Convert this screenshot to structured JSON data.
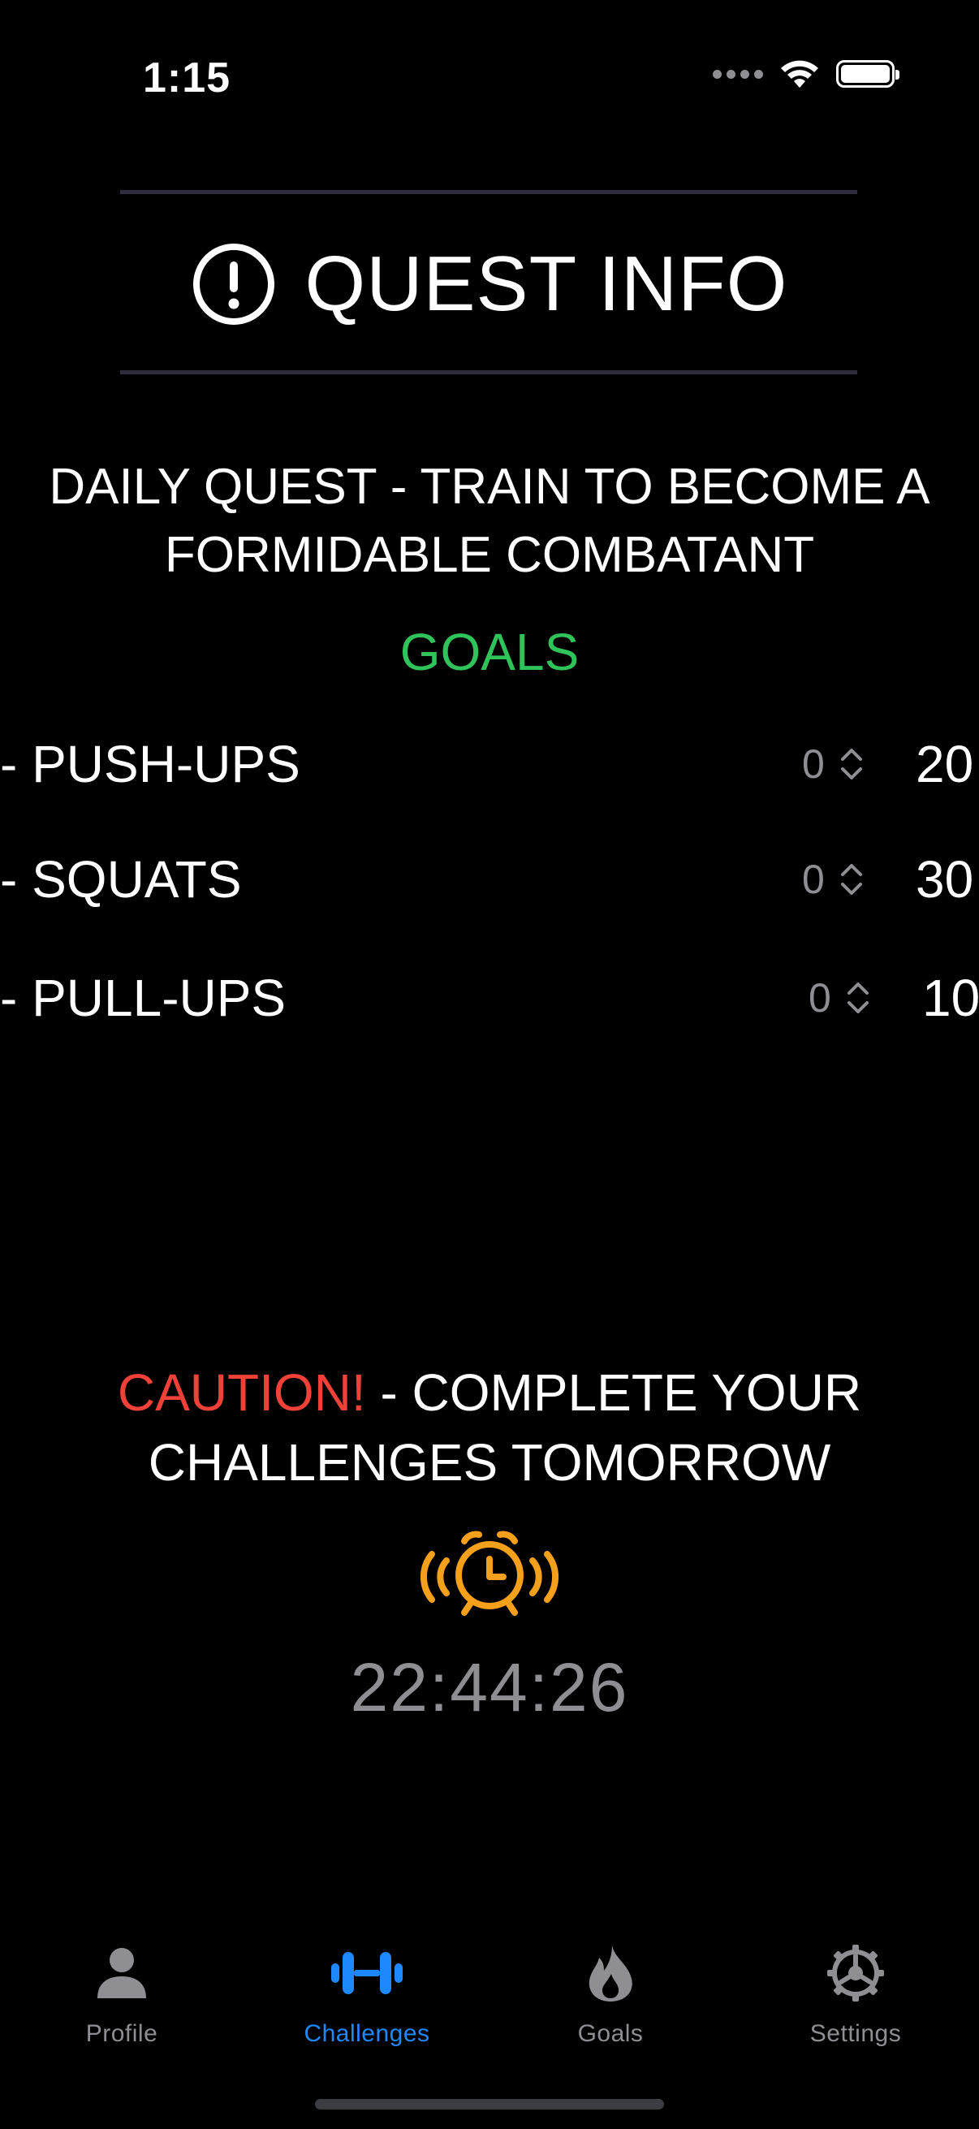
{
  "status_bar": {
    "time": "1:15"
  },
  "header": {
    "title": "QUEST INFO",
    "icon": "exclamation-circle-icon"
  },
  "quest": {
    "title": "DAILY QUEST - TRAIN TO BECOME A FORMIDABLE COMBATANT",
    "goals_heading": "GOALS",
    "goals": [
      {
        "label": "- PUSH-UPS",
        "current": "0",
        "target": "20"
      },
      {
        "label": "- SQUATS",
        "current": "0",
        "target": "30"
      },
      {
        "label": "- PULL-UPS",
        "current": "0",
        "target": "10"
      }
    ]
  },
  "caution": {
    "warning": "CAUTION!",
    "message": " - COMPLETE YOUR CHALLENGES TOMORROW"
  },
  "countdown": {
    "icon": "alarm-clock-icon",
    "time": "22:44:26"
  },
  "tabs": [
    {
      "label": "Profile",
      "icon": "person-icon",
      "active": false
    },
    {
      "label": "Challenges",
      "icon": "dumbbell-icon",
      "active": true
    },
    {
      "label": "Goals",
      "icon": "flame-icon",
      "active": false
    },
    {
      "label": "Settings",
      "icon": "gear-icon",
      "active": false
    }
  ],
  "colors": {
    "background": "#000000",
    "accent": "#1e88ff",
    "goals_green": "#30c35a",
    "caution_red": "#ef4138",
    "alarm_orange": "#f5a01a",
    "muted": "#8e8e93"
  }
}
